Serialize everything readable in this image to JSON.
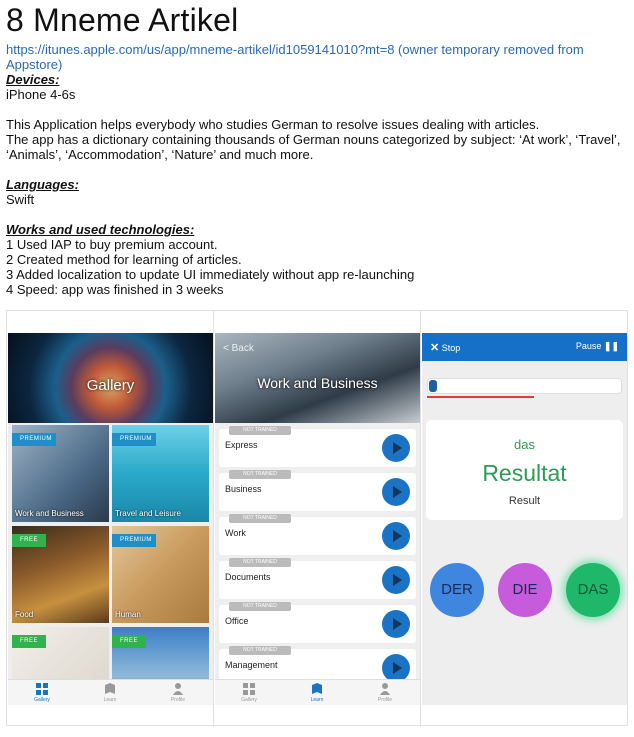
{
  "title": "8 Mneme Artikel",
  "link_text": "https://itunes.apple.com/us/app/mneme-artikel/id1059141010?mt=8 (owner temporary removed from Appstore)",
  "sections": {
    "devices": {
      "heading": "Devices:",
      "text": "iPhone 4-6s"
    },
    "description": {
      "line1": "This Application helps everybody who studies German to resolve issues dealing with articles.",
      "line2": "The app has a dictionary containing thousands of German nouns categorized by subject: ‘At work’, ‘Travel’, ‘Animals’, ‘Accommodation’, ‘Nature’ and much more."
    },
    "languages": {
      "heading": "Languages:",
      "text": "Swift"
    },
    "works": {
      "heading": "Works and used technologies:",
      "items": [
        "1 Used IAP to buy premium account.",
        "2 Created method for learning of articles.",
        "3 Added localization to update UI immediately without app re-launching",
        "4 Speed: app was finished in 3 weeks"
      ]
    }
  },
  "phone1": {
    "banner_title": "Gallery",
    "tiles": [
      {
        "ribbon": "PREMIUM",
        "label": "Work and Business"
      },
      {
        "ribbon": "PREMIUM",
        "label": "Travel and Leisure"
      },
      {
        "ribbon": "FREE",
        "label": "Food"
      },
      {
        "ribbon": "PREMIUM",
        "label": "Human"
      },
      {
        "ribbon": "FREE",
        "label": ""
      },
      {
        "ribbon": "FREE",
        "label": ""
      }
    ],
    "tabs": [
      "Gallery",
      "Learn",
      "Profile"
    ]
  },
  "phone2": {
    "back": "< Back",
    "title": "Work and Business",
    "badge": "NOT TRAINED",
    "rows": [
      "Express",
      "Business",
      "Work",
      "Documents",
      "Office",
      "Management"
    ],
    "tabs": [
      "Gallery",
      "Learn",
      "Profile"
    ]
  },
  "phone3": {
    "stop": "Stop",
    "pause": "Pause",
    "progress": 0.04,
    "error_progress": 0.55,
    "article": "das",
    "word": "Resultat",
    "translation": "Result",
    "buttons": [
      {
        "label": "DER",
        "color": "#3f86e0"
      },
      {
        "label": "DIE",
        "color": "#c65bdc"
      },
      {
        "label": "DAS",
        "color": "#1fb86a"
      }
    ]
  },
  "colors": {
    "link": "#2a6ab1",
    "accent_blue": "#1570c7",
    "green": "#2e9b54"
  }
}
